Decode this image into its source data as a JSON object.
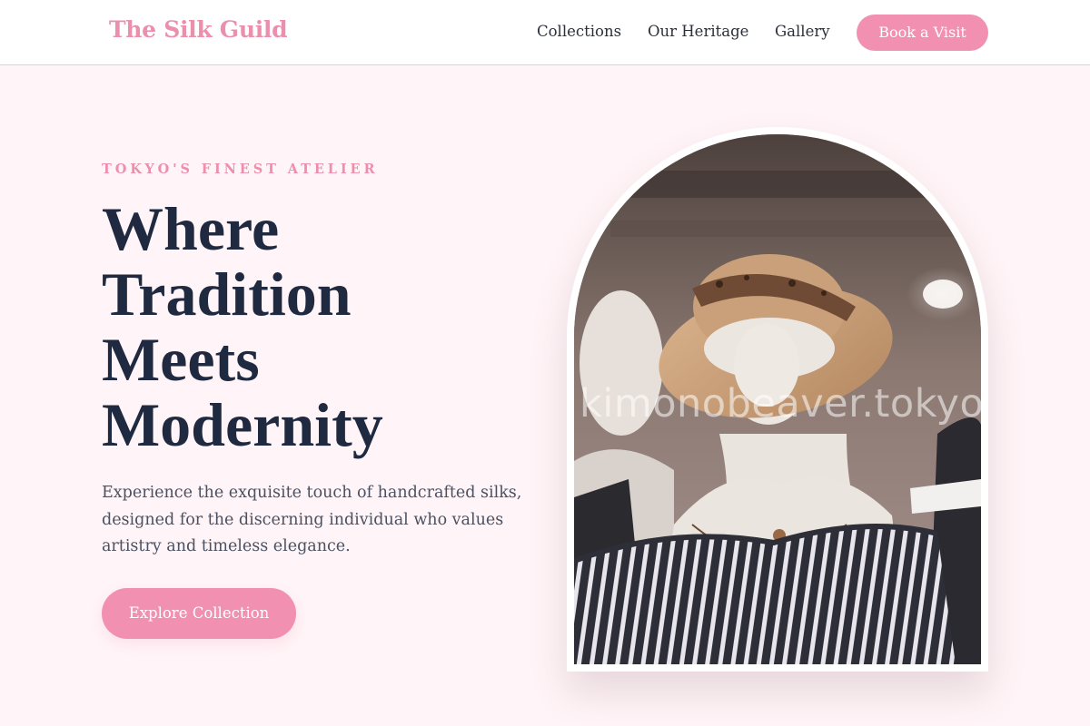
{
  "header": {
    "brand": "The Silk Guild",
    "nav": [
      {
        "label": "Collections"
      },
      {
        "label": "Our Heritage"
      },
      {
        "label": "Gallery"
      }
    ],
    "cta_label": "Book a Visit"
  },
  "hero": {
    "eyebrow": "TOKYO'S FINEST ATELIER",
    "headline_lines": [
      "Where",
      "Tradition",
      "Meets",
      "Modernity"
    ],
    "lede": "Experience the exquisite touch of handcrafted silks, designed for the discerning individual who values artistry and timeless elegance.",
    "cta_label": "Explore Collection"
  },
  "image": {
    "watermark": "kimonobeaver.tokyo"
  },
  "colors": {
    "brand_pink": "#f190b1",
    "heading_navy": "#1f2a40",
    "page_bg": "#fff4f7"
  }
}
